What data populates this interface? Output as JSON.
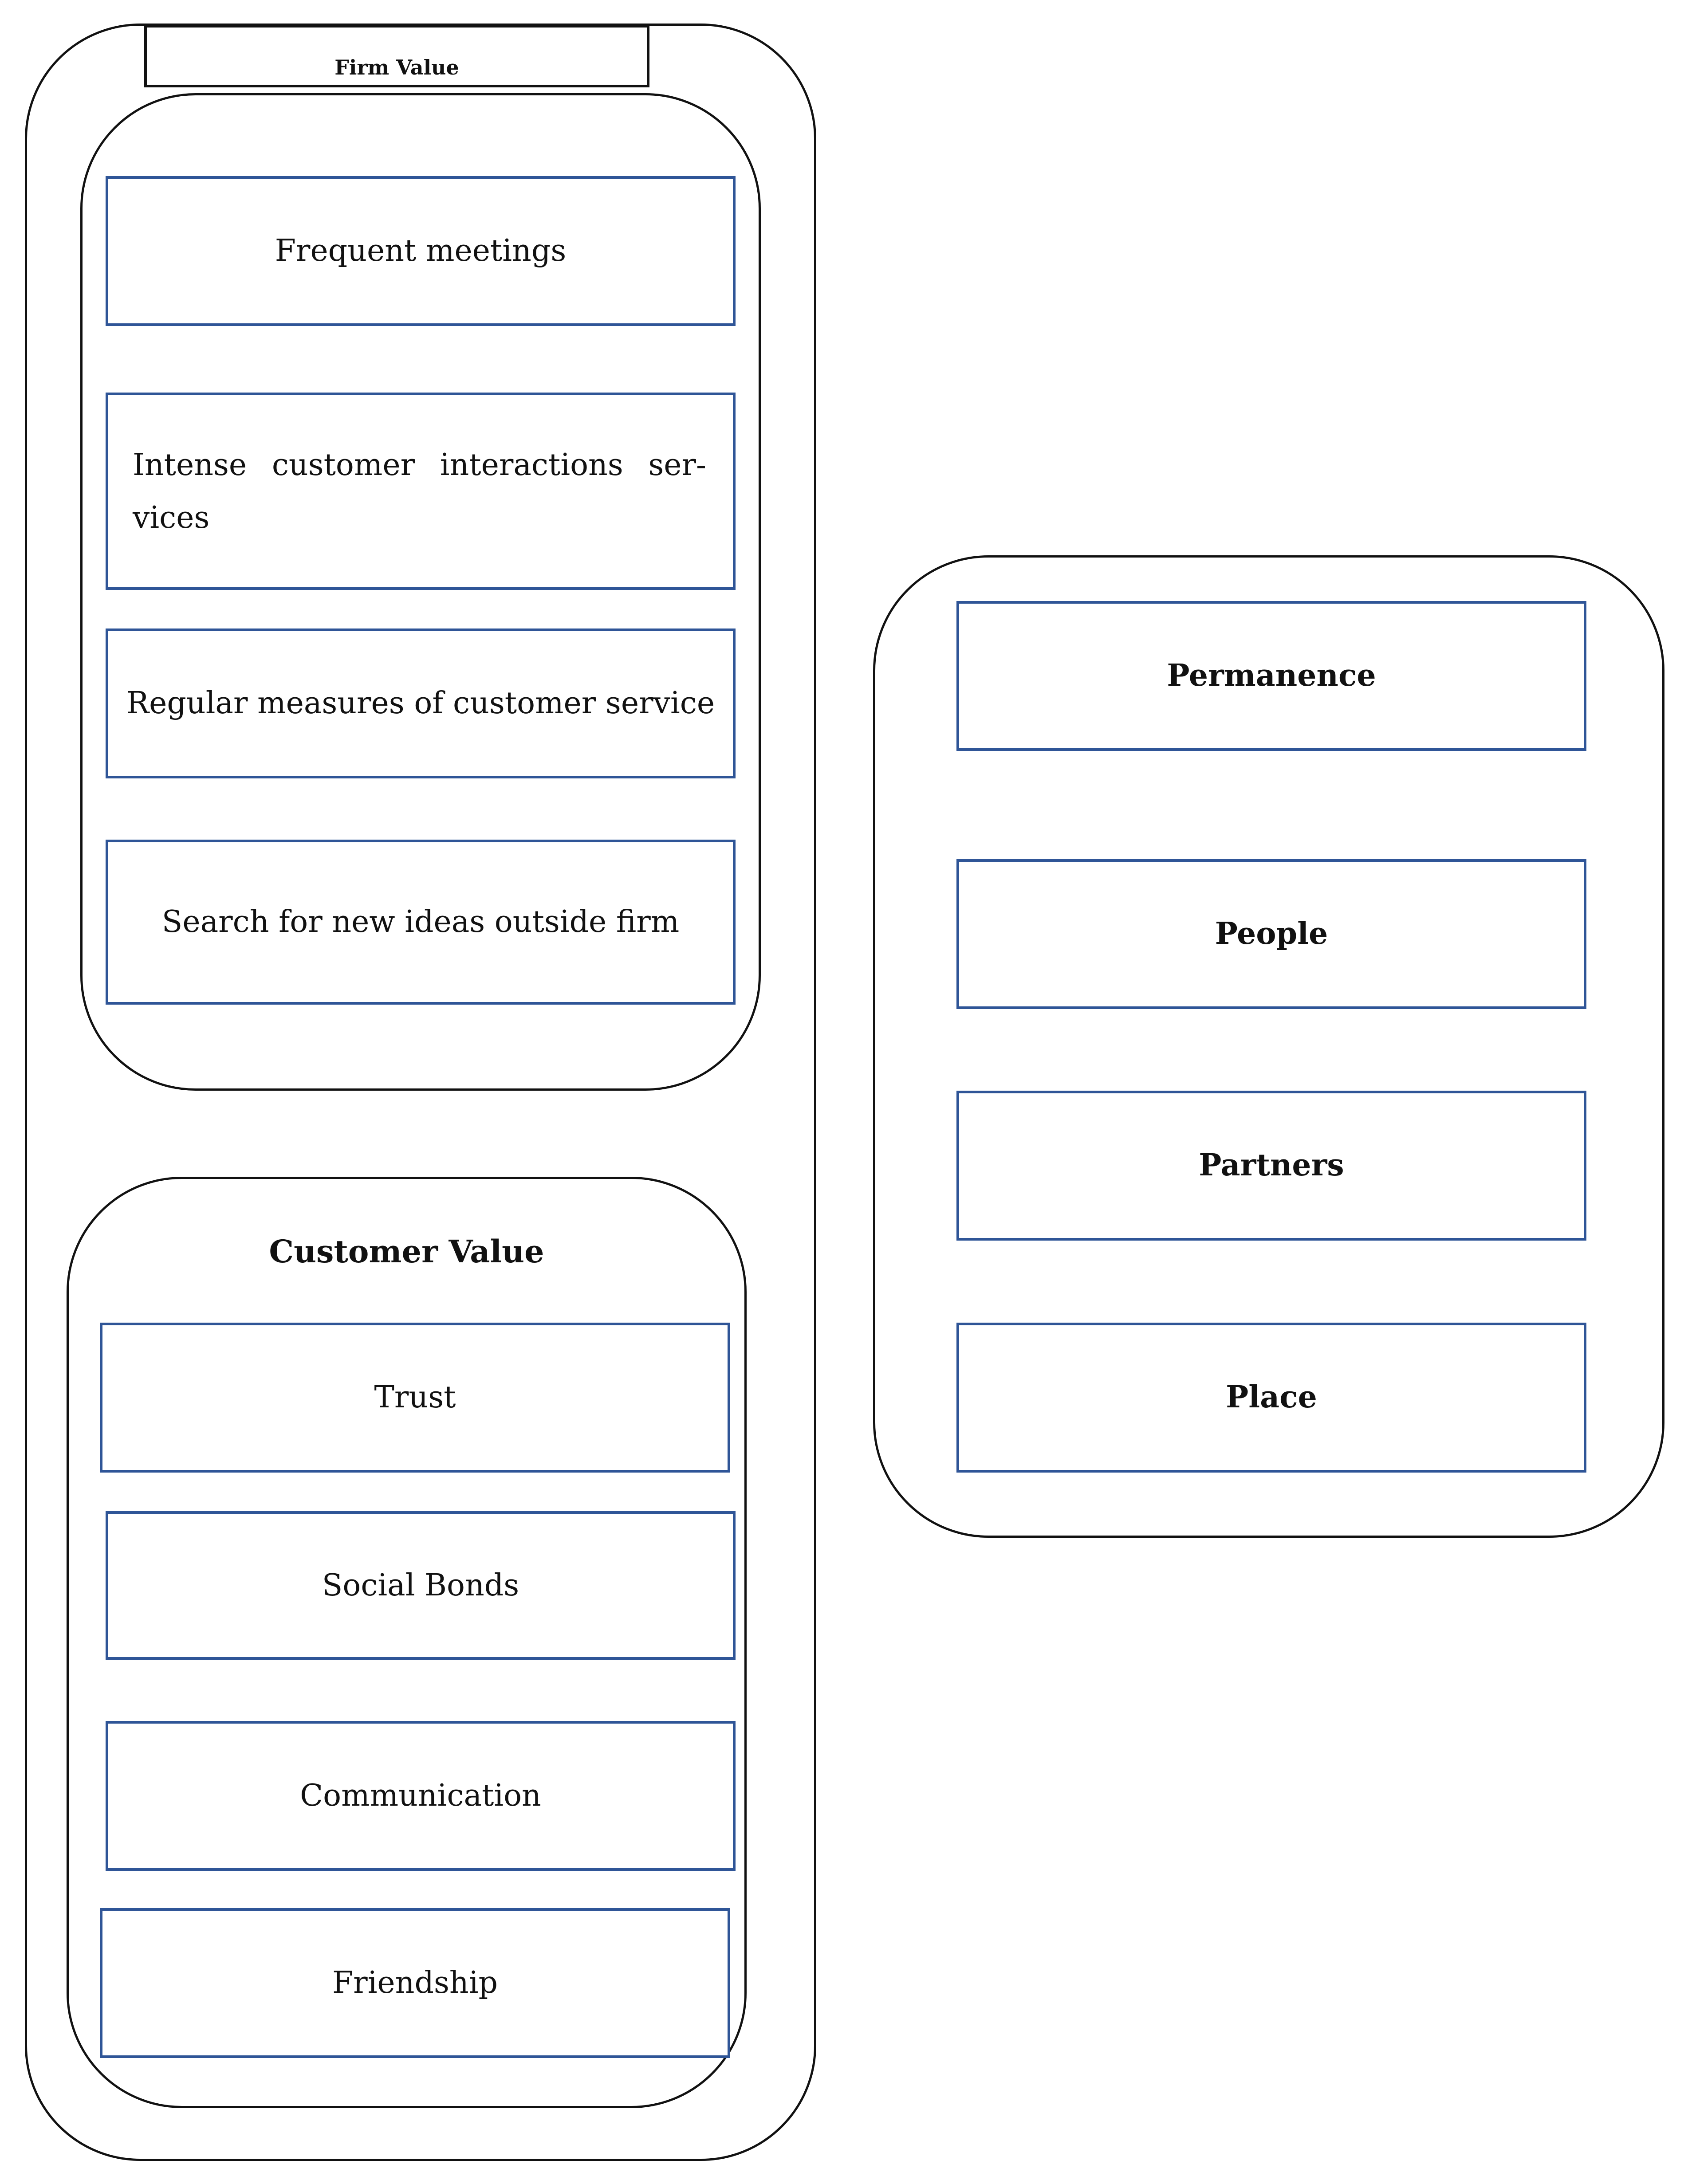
{
  "firm_value": {
    "header": "Firm Value",
    "items": [
      "Frequent meetings",
      "Intense customer interactions ser- vices",
      "Regular measures of customer service",
      "Search for new ideas outside firm"
    ]
  },
  "customer_value": {
    "title": "Customer Value",
    "items": [
      "Trust",
      "Social Bonds",
      "Communication",
      "Friendship"
    ]
  },
  "right_group": {
    "items": [
      "Permanence",
      "People",
      "Partners",
      "Place"
    ]
  },
  "colors": {
    "box_border": "#2F5597",
    "container_border": "#111111"
  }
}
